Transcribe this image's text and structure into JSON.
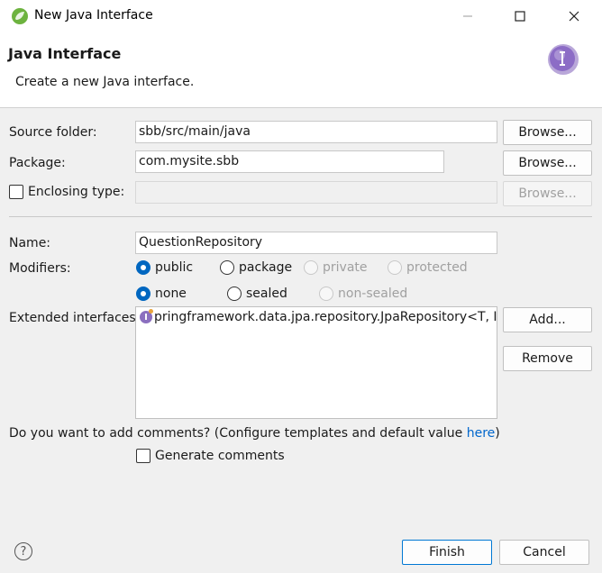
{
  "window": {
    "title": "New Java Interface"
  },
  "header": {
    "title": "Java Interface",
    "subtitle": "Create a new Java interface."
  },
  "form": {
    "source_folder": {
      "label": "Source folder:",
      "value": "sbb/src/main/java",
      "button": "Browse..."
    },
    "package": {
      "label": "Package:",
      "value": "com.mysite.sbb",
      "button": "Browse..."
    },
    "enclosing_type": {
      "label": "Enclosing type:",
      "value": "",
      "button": "Browse..."
    },
    "name": {
      "label": "Name:",
      "value": "QuestionRepository"
    },
    "modifiers": {
      "label": "Modifiers:",
      "access": [
        "public",
        "package",
        "private",
        "protected"
      ],
      "other": [
        "none",
        "sealed",
        "non-sealed"
      ]
    },
    "extended_interfaces": {
      "label": "Extended interfaces:",
      "items": [
        "org.springframework.data.jpa.repository.JpaRepository<T, ID>"
      ],
      "visible_text": "pringframework.data.jpa.repository.JpaRepository<T, ID>",
      "add_button": "Add...",
      "remove_button": "Remove"
    },
    "comments": {
      "question": "Do you want to add comments? (Configure templates and default value ",
      "link": "here",
      "suffix": ")",
      "generate_label": "Generate comments"
    }
  },
  "footer": {
    "help": "?",
    "finish": "Finish",
    "cancel": "Cancel"
  },
  "colors": {
    "accent": "#0067c0",
    "link": "#0066cc",
    "interface_icon": "#8b6fbf"
  }
}
